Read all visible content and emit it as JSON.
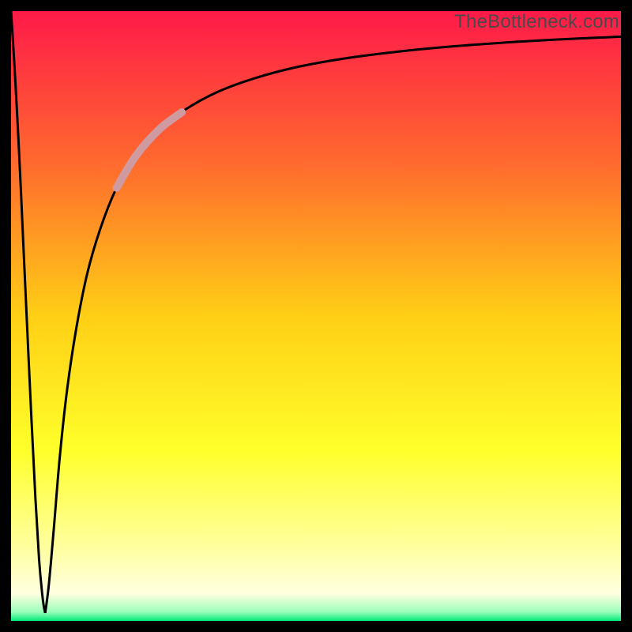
{
  "watermark": "TheBottleneck.com",
  "chart_data": {
    "type": "line",
    "title": "",
    "xlabel": "",
    "ylabel": "",
    "xlim": [
      0,
      100
    ],
    "ylim": [
      0,
      100
    ],
    "grid": false,
    "legend": false,
    "gradient_stops": [
      {
        "offset": 0.0,
        "color": "#ff1a49"
      },
      {
        "offset": 0.25,
        "color": "#ff6a2e"
      },
      {
        "offset": 0.5,
        "color": "#ffcf15"
      },
      {
        "offset": 0.72,
        "color": "#ffff2a"
      },
      {
        "offset": 0.88,
        "color": "#ffffa0"
      },
      {
        "offset": 0.955,
        "color": "#ffffe0"
      },
      {
        "offset": 0.985,
        "color": "#9cffba"
      },
      {
        "offset": 1.0,
        "color": "#00e87a"
      }
    ],
    "series": [
      {
        "name": "bottleneck-curve-left",
        "stroke": "#000000",
        "stroke_width": 3,
        "x": [
          0.0,
          0.5,
          1.0,
          1.5,
          2.0,
          2.6,
          3.3,
          4.0,
          4.6,
          5.1,
          5.4,
          5.6
        ],
        "y": [
          100,
          92,
          83,
          73,
          62,
          49,
          34,
          20,
          10,
          4.5,
          2.2,
          1.3
        ]
      },
      {
        "name": "bottleneck-curve-right",
        "stroke": "#000000",
        "stroke_width": 3,
        "x": [
          5.6,
          6.2,
          7.0,
          8.0,
          9.2,
          10.7,
          12.5,
          14.7,
          17.3,
          20.5,
          24.3,
          28.8,
          34.0,
          40.0,
          46.8,
          54.5,
          63.0,
          72.3,
          82.0,
          91.0,
          100.0
        ],
        "y": [
          1.3,
          6.0,
          15,
          27,
          38,
          48,
          57,
          64.5,
          71,
          76.3,
          80.6,
          84,
          86.8,
          89,
          90.8,
          92.2,
          93.3,
          94.2,
          94.9,
          95.4,
          95.8
        ]
      },
      {
        "name": "highlight-segment",
        "stroke": "#cf9aa0",
        "stroke_width": 10,
        "linecap": "round",
        "x": [
          17.3,
          20.5,
          24.3,
          28.0
        ],
        "y": [
          71.0,
          76.3,
          80.6,
          83.4
        ]
      }
    ]
  }
}
